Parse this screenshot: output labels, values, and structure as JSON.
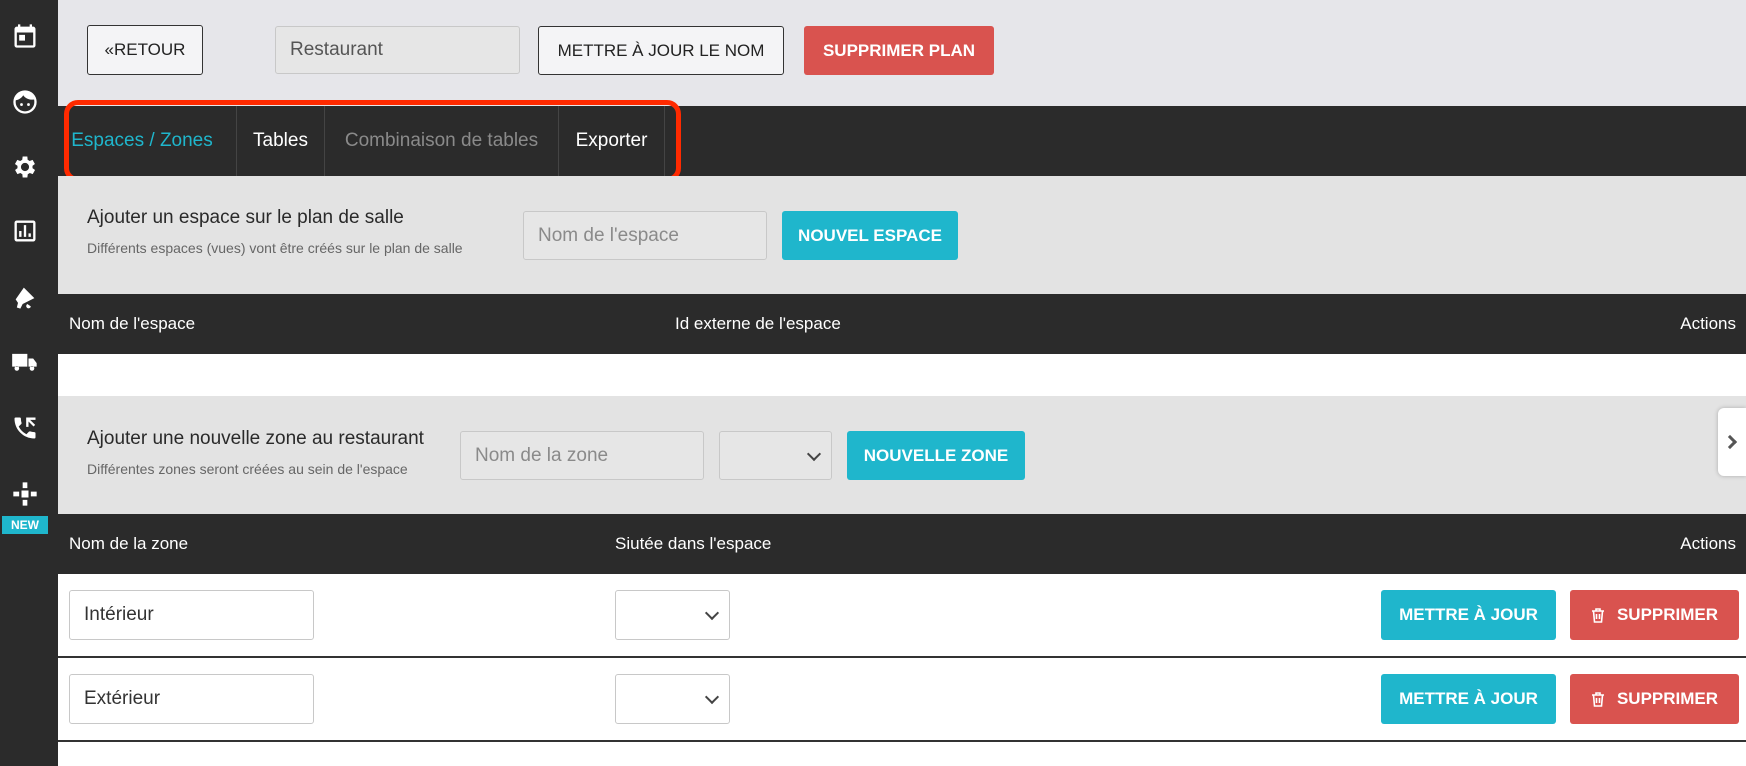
{
  "sidebar": {
    "icons": [
      "calendar-icon",
      "face-icon",
      "gear-icon",
      "chart-icon",
      "megaphone-icon",
      "truck-icon",
      "phone-icon",
      "puzzle-icon"
    ],
    "new_badge": "NEW"
  },
  "topbar": {
    "back_label": "«RETOUR",
    "plan_name_value": "Restaurant",
    "update_name_label": "METTRE À JOUR LE NOM",
    "delete_plan_label": "SUPPRIMER PLAN"
  },
  "tabs": [
    {
      "label": "Espaces / Zones",
      "state": "active"
    },
    {
      "label": "Tables",
      "state": "normal"
    },
    {
      "label": "Combinaison de tables",
      "state": "disabled"
    },
    {
      "label": "Exporter",
      "state": "normal"
    }
  ],
  "space_section": {
    "title": "Ajouter un espace sur le plan de salle",
    "subtitle": "Différents espaces (vues) vont être créés sur le plan de salle",
    "input_placeholder": "Nom de l'espace",
    "button_label": "NOUVEL ESPACE"
  },
  "space_table": {
    "headers": [
      "Nom de l'espace",
      "Id externe de l'espace",
      "Actions"
    ]
  },
  "zone_section": {
    "title": "Ajouter une nouvelle zone au restaurant",
    "subtitle": "Différentes zones seront créées au sein de l'espace",
    "input_placeholder": "Nom de la zone",
    "button_label": "NOUVELLE ZONE"
  },
  "zone_table": {
    "headers": [
      "Nom de la zone",
      "Siutée dans l'espace",
      "Actions"
    ],
    "rows": [
      {
        "name": "Intérieur",
        "update_label": "METTRE À JOUR",
        "delete_label": "SUPPRIMER"
      },
      {
        "name": "Extérieur",
        "update_label": "METTRE À JOUR",
        "delete_label": "SUPPRIMER"
      }
    ]
  },
  "colors": {
    "accent": "#1fb6cc",
    "danger": "#d9534f",
    "dark": "#2b2b2b",
    "highlight": "#ff2a00"
  }
}
